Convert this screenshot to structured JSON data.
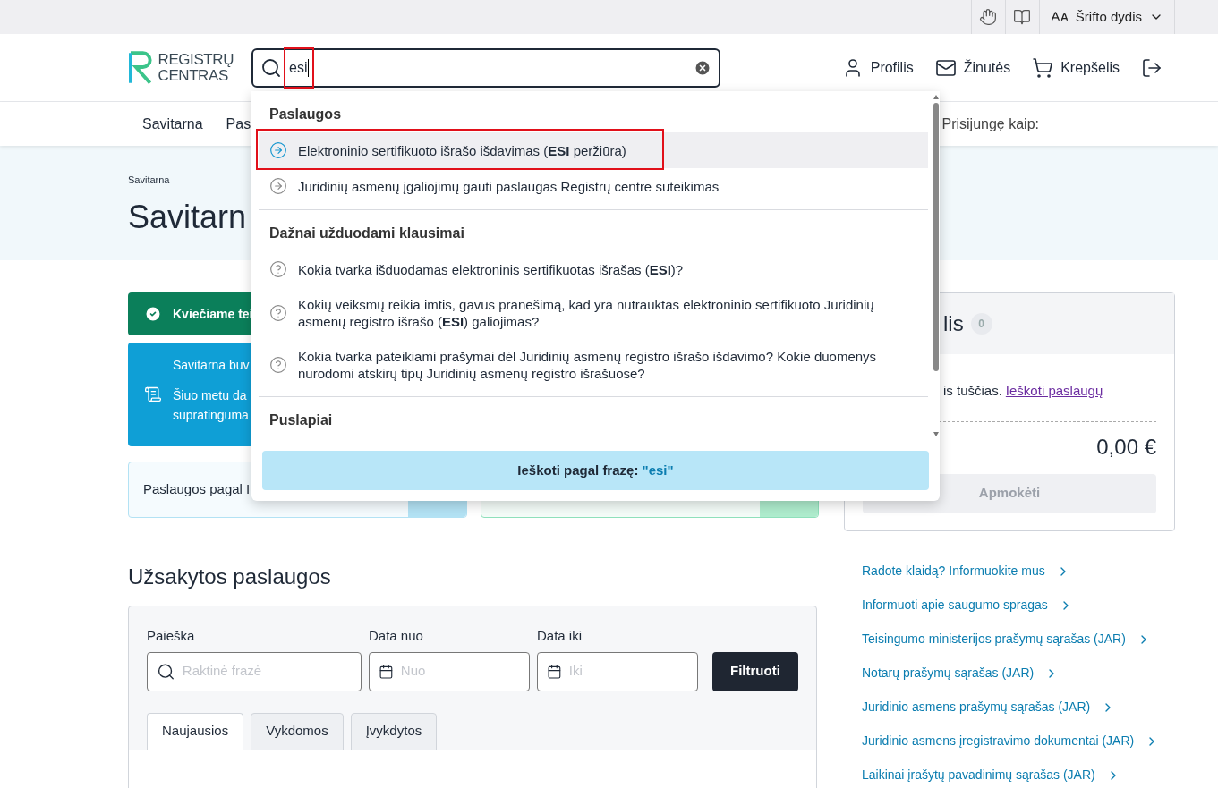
{
  "utility_bar": {
    "font_size_label": "Šrifto dydis"
  },
  "header": {
    "logo": [
      "REGISTRŲ",
      "CENTRAS"
    ],
    "search": {
      "value": "esi",
      "highlighted": true
    },
    "nav": [
      {
        "label": "Profilis",
        "kind": "profile"
      },
      {
        "label": "Žinutės",
        "kind": "messages"
      },
      {
        "label": "Krepšelis",
        "kind": "cart"
      },
      {
        "kind": "logout"
      }
    ]
  },
  "menu": {
    "items": [
      "Savitarna",
      "Pas"
    ],
    "login_label": "Prisijungę kaip:"
  },
  "hero": {
    "breadcrumb": "Savitarna",
    "title": "Savitarn"
  },
  "alerts": [
    {
      "kind": "success",
      "lines": [
        "Kviečiame tei"
      ]
    },
    {
      "kind": "info",
      "lines": [
        "Savitarna buv",
        "Šiuo metu da",
        "supratinguma"
      ]
    }
  ],
  "cards": [
    {
      "kind": "blue",
      "label": "Paslaugos pagal I"
    },
    {
      "kind": "green"
    }
  ],
  "cart": {
    "title": "lis",
    "count": "0",
    "empty_text": "is tuščias.",
    "link": "Ieškoti paslaugų",
    "total": "0,00 €",
    "pay_button": {
      "label": "Apmokėti",
      "disabled": true
    }
  },
  "links": [
    "Radote klaidą? Informuokite mus",
    "Informuoti apie saugumo spragas",
    "Teisingumo ministerijos prašymų sąrašas (JAR)",
    "Notarų prašymų sąrašas (JAR)",
    "Juridinio asmens prašymų sąrašas (JAR)",
    "Juridinio asmens įregistravimo dokumentai (JAR)",
    "Laikinai įrašytų pavadinimų sąrašas (JAR)"
  ],
  "orders": {
    "title": "Užsakytos paslaugos",
    "filters": [
      {
        "kind": "search",
        "label": "Paieška",
        "placeholder": "Raktinė frazė"
      },
      {
        "kind": "date",
        "label": "Data nuo",
        "placeholder": "Nuo"
      },
      {
        "kind": "date",
        "label": "Data iki",
        "placeholder": "Iki"
      }
    ],
    "filter_button": "Filtruoti",
    "tabs": [
      {
        "label": "Naujausios",
        "selected": true
      },
      {
        "label": "Vykdomos",
        "selected": false
      },
      {
        "label": "Įvykdytos",
        "selected": false
      }
    ]
  },
  "search_dropdown": {
    "sections": [
      {
        "title": "Paslaugos",
        "kind": "service",
        "items": [
          {
            "text": "Elektroninio sertifikuoto išrašo išdavimas (**ESI** peržiūra)",
            "hovered": true,
            "highlighted": true
          },
          {
            "text": "Juridinių asmenų įgaliojimų gauti paslaugas Registrų centre suteikimas",
            "hovered": false,
            "highlighted": false
          }
        ]
      },
      {
        "title": "Dažnai užduodami klausimai",
        "kind": "faq",
        "items": [
          {
            "text": "Kokia tvarka išduodamas elektroninis sertifikuotas išrašas (**ESI**)?",
            "hovered": false,
            "highlighted": false
          },
          {
            "text": "Kokių veiksmų reikia imtis, gavus pranešimą, kad yra nutrauktas elektroninio sertifikuoto Juridinių asmenų registro išrašo (**ESI**) galiojimas?",
            "hovered": false,
            "highlighted": false
          },
          {
            "text": "Kokia tvarka pateikiami prašymai dėl Juridinių asmenų registro išrašo išdavimo? Kokie duomenys nurodomi atskirų tipų Juridinių asmenų registro išrašuose?",
            "hovered": false,
            "highlighted": false
          }
        ]
      },
      {
        "title": "Puslapiai",
        "kind": "page"
      }
    ],
    "search_phrase": {
      "label": "Ieškoti pagal frazę:",
      "query": "\"esi\""
    }
  }
}
